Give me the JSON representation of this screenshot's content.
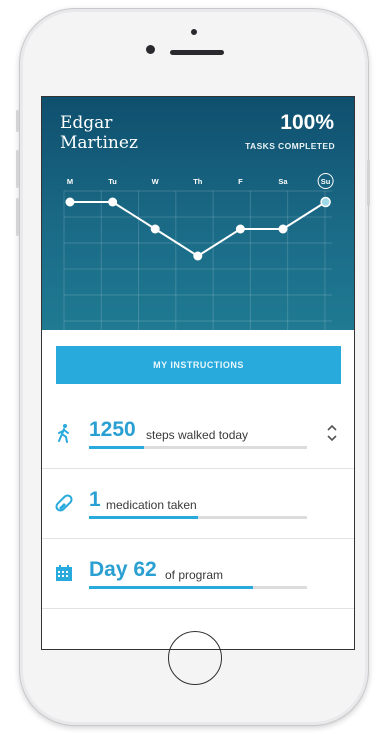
{
  "user": {
    "name": "Edgar Martinez"
  },
  "progress": {
    "percent_label": "100%",
    "label": "TASKS COMPLETED"
  },
  "week_chart": {
    "days": [
      "M",
      "Tu",
      "W",
      "Th",
      "F",
      "Sa",
      "Su"
    ],
    "selected_day": "Su",
    "levels": [
      2,
      2,
      1,
      0,
      1,
      1,
      2
    ],
    "colors": {
      "line": "#ffffff",
      "point": "#ffffff",
      "selected_point": "#9fd8e6"
    }
  },
  "instructions_button": {
    "label": "MY INSTRUCTIONS"
  },
  "stats": [
    {
      "icon": "walking-person-icon",
      "value": "1250",
      "caption": "steps walked today",
      "progress": 0.25
    },
    {
      "icon": "pill-icon",
      "value": "1",
      "caption": "medication taken",
      "progress": 0.5
    },
    {
      "icon": "calendar-icon",
      "value": "Day 62",
      "caption": "of program",
      "progress": 0.75
    }
  ],
  "colors": {
    "accent": "#29aadd",
    "header_bg": "#16607f"
  }
}
